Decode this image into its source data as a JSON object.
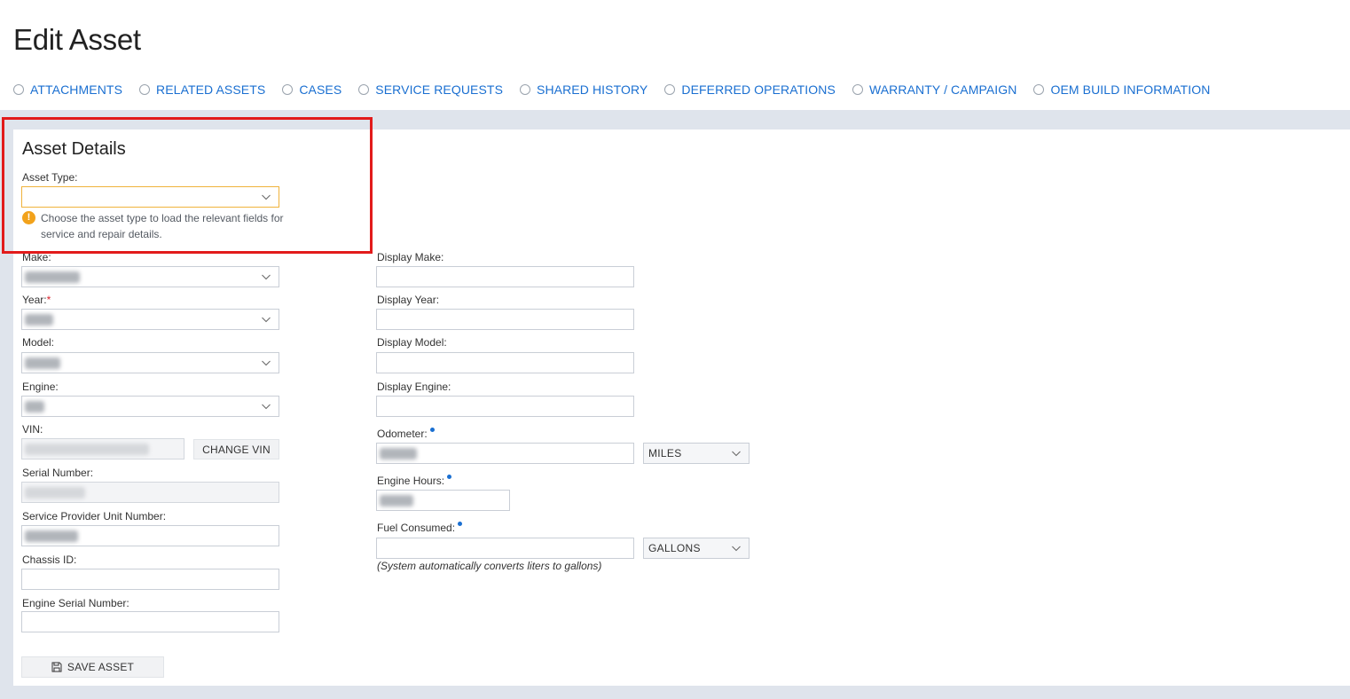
{
  "page": {
    "title": "Edit Asset"
  },
  "tabs": [
    {
      "label": "ATTACHMENTS"
    },
    {
      "label": "RELATED ASSETS"
    },
    {
      "label": "CASES"
    },
    {
      "label": "SERVICE REQUESTS"
    },
    {
      "label": "SHARED HISTORY"
    },
    {
      "label": "DEFERRED OPERATIONS"
    },
    {
      "label": "WARRANTY / CAMPAIGN"
    },
    {
      "label": "OEM BUILD INFORMATION"
    }
  ],
  "section": {
    "title": "Asset Details",
    "asset_type_label": "Asset Type:",
    "asset_type_value": "",
    "hint": "Choose the asset type to load the relevant fields for service and repair details."
  },
  "left_fields": {
    "make_label": "Make:",
    "year_label": "Year:",
    "year_required": "*",
    "model_label": "Model:",
    "engine_label": "Engine:",
    "vin_label": "VIN:",
    "change_vin_button": "CHANGE VIN",
    "serial_number_label": "Serial Number:",
    "unit_number_label": "Service Provider Unit Number:",
    "chassis_id_label": "Chassis ID:",
    "chassis_id_value": "",
    "engine_serial_label": "Engine Serial Number:",
    "engine_serial_value": ""
  },
  "right_fields": {
    "display_make_label": "Display Make:",
    "display_year_label": "Display Year:",
    "display_model_label": "Display Model:",
    "display_engine_label": "Display Engine:",
    "odometer_label": "Odometer:",
    "odometer_unit": "MILES",
    "engine_hours_label": "Engine Hours:",
    "fuel_consumed_label": "Fuel Consumed:",
    "fuel_unit": "GALLONS",
    "fuel_note": "(System automatically converts liters to gallons)"
  },
  "actions": {
    "save_label": "SAVE ASSET"
  },
  "colors": {
    "link": "#1a6fd1",
    "highlight": "#e21b1b",
    "warning": "#f2a21b",
    "band": "#dfe4ec"
  }
}
